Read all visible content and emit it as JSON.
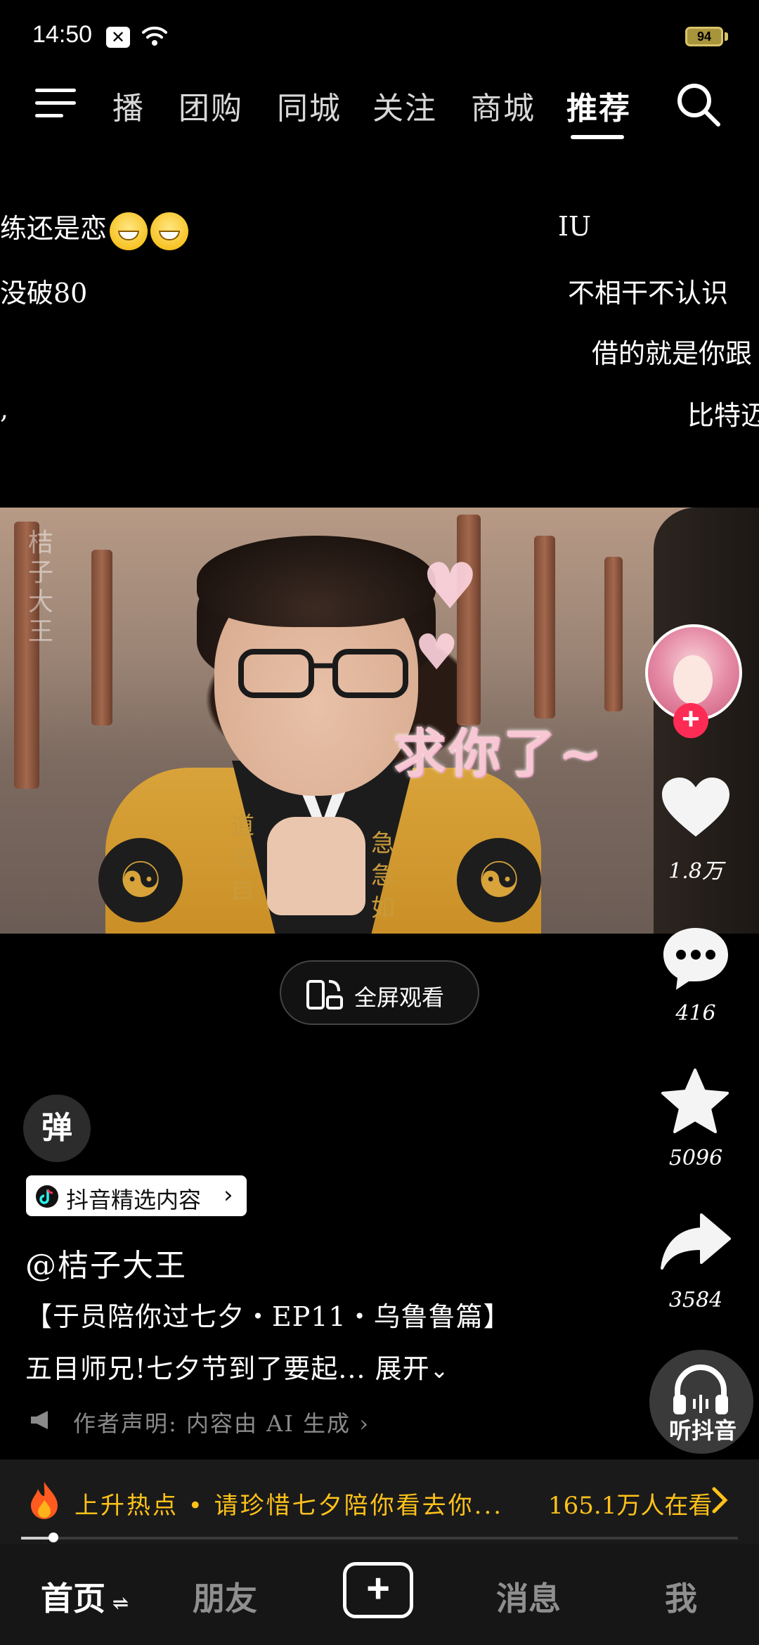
{
  "status_bar": {
    "time": "14:50",
    "notification_icon": "x-box-icon",
    "battery": "94"
  },
  "top_nav": {
    "items": [
      "播",
      "团购",
      "同城",
      "关注",
      "商城",
      "推荐"
    ],
    "active": "推荐"
  },
  "danmaku": [
    {
      "text": "练还是恋"
    },
    {
      "text": "IU"
    },
    {
      "text": "没破80"
    },
    {
      "text": "不相干不认识"
    },
    {
      "text": "借的就是你跟"
    },
    {
      "text": "比特迈"
    },
    {
      "text": ","
    }
  ],
  "video": {
    "caption": "求你了~",
    "watermark": "桔子大王",
    "robe_text_left": "道法自",
    "robe_text_right": "急急如"
  },
  "actions": {
    "likes": "1.8万",
    "comments": "416",
    "favorites": "5096",
    "shares": "3584",
    "listen_label": "听抖音"
  },
  "fullscreen": {
    "label": "全屏观看"
  },
  "info": {
    "danmu_toggle": "弹",
    "tag": "抖音精选内容",
    "author": "@桔子大王",
    "title_line": "【于员陪你过七夕・EP11・乌鲁鲁篇】",
    "desc_line": "五目师兄!七夕节到了要起...",
    "expand_label": "展开",
    "notice": "作者声明: 内容由 AI 生成"
  },
  "hot": {
    "text": "上升热点 • 请珍惜七夕陪你看去你...",
    "count": "165.1万人在看",
    "progress": 0.045
  },
  "tabs": {
    "home": "首页",
    "friends": "朋友",
    "messages": "消息",
    "me": "我"
  },
  "colors": {
    "accent_red": "#fe2c55",
    "hot_yellow": "#ffc21a"
  }
}
